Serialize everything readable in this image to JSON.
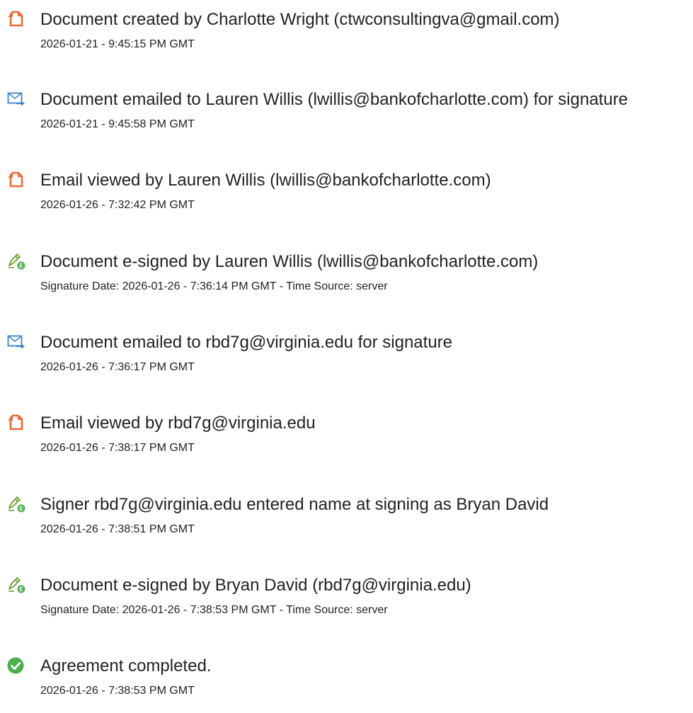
{
  "colors": {
    "doc_icon": "#ee6a35",
    "email_icon": "#3b86c8",
    "sign_icon_pen": "#6a9d2e",
    "sign_icon_badge": "#4fae4f",
    "complete_icon": "#4fae4f",
    "text": "#222222"
  },
  "events": [
    {
      "icon": "document-icon",
      "title": "Document created by Charlotte Wright (ctwconsultingva@gmail.com)",
      "meta": "2026-01-21 - 9:45:15 PM GMT"
    },
    {
      "icon": "email-icon",
      "title": "Document emailed to Lauren Willis (lwillis@bankofcharlotte.com) for signature",
      "meta": "2026-01-21 - 9:45:58 PM GMT"
    },
    {
      "icon": "document-icon",
      "title": "Email viewed by Lauren Willis (lwillis@bankofcharlotte.com)",
      "meta": "2026-01-26 - 7:32:42 PM GMT"
    },
    {
      "icon": "esign-icon",
      "title": "Document e-signed by Lauren Willis (lwillis@bankofcharlotte.com)",
      "meta": "Signature Date: 2026-01-26 - 7:36:14 PM GMT - Time Source: server"
    },
    {
      "icon": "email-icon",
      "title": "Document emailed to rbd7g@virginia.edu for signature",
      "meta": "2026-01-26 - 7:36:17 PM GMT"
    },
    {
      "icon": "document-icon",
      "title": "Email viewed by rbd7g@virginia.edu",
      "meta": "2026-01-26 - 7:38:17 PM GMT"
    },
    {
      "icon": "esign-icon",
      "title": "Signer rbd7g@virginia.edu entered name at signing as Bryan David",
      "meta": "2026-01-26 - 7:38:51 PM GMT"
    },
    {
      "icon": "esign-icon",
      "title": "Document e-signed by Bryan David (rbd7g@virginia.edu)",
      "meta": "Signature Date: 2026-01-26 - 7:38:53 PM GMT - Time Source: server"
    },
    {
      "icon": "check-circle-icon",
      "title": "Agreement completed.",
      "meta": "2026-01-26 - 7:38:53 PM GMT"
    }
  ]
}
